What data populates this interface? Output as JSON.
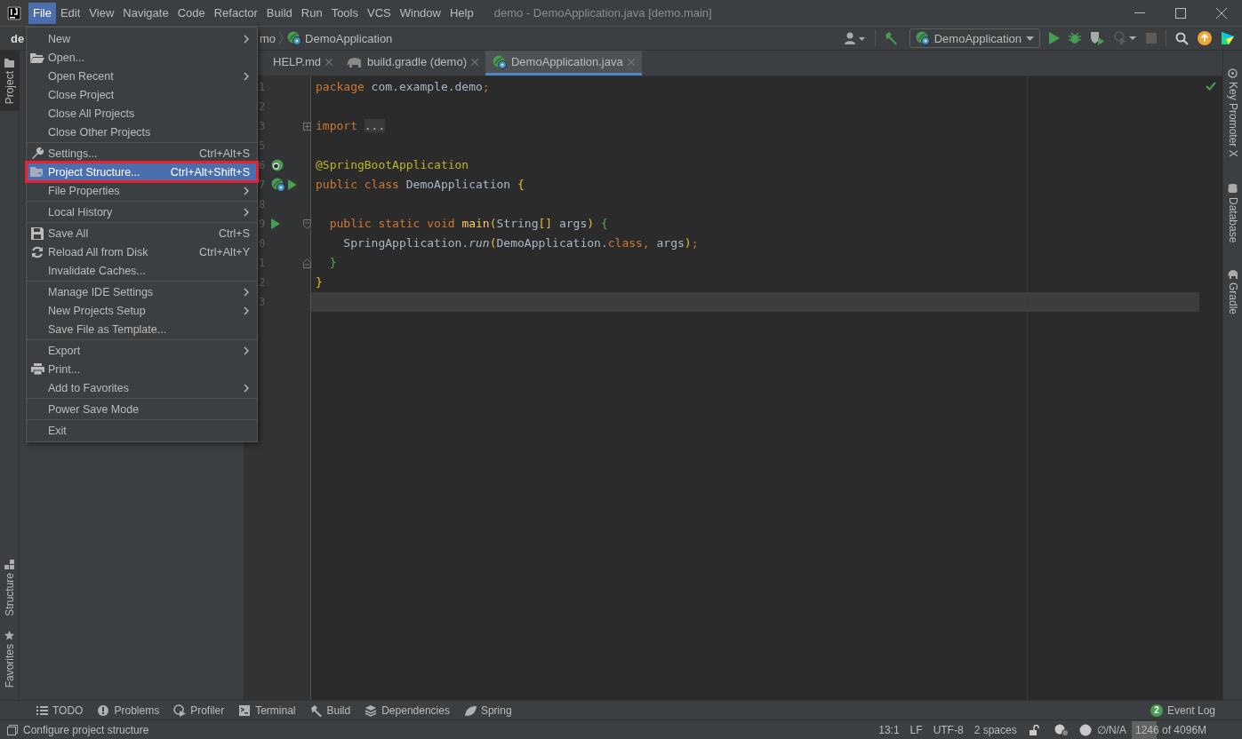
{
  "window": {
    "title": "demo - DemoApplication.java [demo.main]"
  },
  "menu_bar": [
    {
      "label": "File",
      "selected": true
    },
    {
      "label": "Edit",
      "selected": false
    },
    {
      "label": "View",
      "selected": false
    },
    {
      "label": "Navigate",
      "selected": false
    },
    {
      "label": "Code",
      "selected": false
    },
    {
      "label": "Refactor",
      "selected": false
    },
    {
      "label": "Build",
      "selected": false
    },
    {
      "label": "Run",
      "selected": false
    },
    {
      "label": "Tools",
      "selected": false
    },
    {
      "label": "VCS",
      "selected": false
    },
    {
      "label": "Window",
      "selected": false
    },
    {
      "label": "Help",
      "selected": false
    }
  ],
  "navigation_bar": {
    "project": "de",
    "breadcrumbs": [
      "mo",
      "DemoApplication"
    ],
    "run_configuration": "DemoApplication"
  },
  "file_menu": [
    {
      "kind": "item",
      "label": "New",
      "submenu": true,
      "selected": false
    },
    {
      "kind": "item",
      "label": "Open...",
      "submenu": false,
      "selected": false
    },
    {
      "kind": "item",
      "label": "Open Recent",
      "submenu": true,
      "selected": false
    },
    {
      "kind": "item",
      "label": "Close Project",
      "submenu": false,
      "selected": false
    },
    {
      "kind": "item",
      "label": "Close All Projects",
      "submenu": false,
      "selected": false
    },
    {
      "kind": "item",
      "label": "Close Other Projects",
      "submenu": false,
      "selected": false
    },
    {
      "kind": "separator"
    },
    {
      "kind": "item",
      "label": "Settings...",
      "shortcut": "Ctrl+Alt+S",
      "submenu": false,
      "selected": false
    },
    {
      "kind": "item",
      "label": "Project Structure...",
      "shortcut": "Ctrl+Alt+Shift+S",
      "submenu": false,
      "selected": true
    },
    {
      "kind": "item",
      "label": "File Properties",
      "submenu": true,
      "selected": false
    },
    {
      "kind": "separator"
    },
    {
      "kind": "item",
      "label": "Local History",
      "submenu": true,
      "selected": false
    },
    {
      "kind": "separator"
    },
    {
      "kind": "item",
      "label": "Save All",
      "shortcut": "Ctrl+S",
      "submenu": false,
      "selected": false
    },
    {
      "kind": "item",
      "label": "Reload All from Disk",
      "shortcut": "Ctrl+Alt+Y",
      "submenu": false,
      "selected": false
    },
    {
      "kind": "item",
      "label": "Invalidate Caches...",
      "submenu": false,
      "selected": false
    },
    {
      "kind": "separator"
    },
    {
      "kind": "item",
      "label": "Manage IDE Settings",
      "submenu": true,
      "selected": false
    },
    {
      "kind": "item",
      "label": "New Projects Setup",
      "submenu": true,
      "selected": false
    },
    {
      "kind": "item",
      "label": "Save File as Template...",
      "submenu": false,
      "selected": false
    },
    {
      "kind": "separator"
    },
    {
      "kind": "item",
      "label": "Export",
      "submenu": true,
      "selected": false
    },
    {
      "kind": "item",
      "label": "Print...",
      "submenu": false,
      "selected": false
    },
    {
      "kind": "item",
      "label": "Add to Favorites",
      "submenu": true,
      "selected": false
    },
    {
      "kind": "separator"
    },
    {
      "kind": "item",
      "label": "Power Save Mode",
      "submenu": false,
      "selected": false
    },
    {
      "kind": "separator"
    },
    {
      "kind": "item",
      "label": "Exit",
      "submenu": false,
      "selected": false
    }
  ],
  "left_stripe": {
    "top": [
      {
        "label": "Project",
        "selected": true
      }
    ],
    "bottom": [
      {
        "label": "Structure",
        "selected": false
      },
      {
        "label": "Favorites",
        "selected": false
      }
    ]
  },
  "right_stripe": [
    {
      "label": "Key Promoter X"
    },
    {
      "label": "Database"
    },
    {
      "label": "Gradle"
    }
  ],
  "editor_tabs": [
    {
      "label": "HELP.md",
      "selected": false
    },
    {
      "label": "build.gradle (demo)",
      "selected": false
    },
    {
      "label": "DemoApplication.java",
      "selected": true
    }
  ],
  "code_lines": [
    {
      "number": "1",
      "current": false,
      "tokens": [
        {
          "kind": "keyword",
          "text": "package"
        },
        {
          "kind": "plain",
          "text": " com.example.demo"
        },
        {
          "kind": "keyword",
          "text": ";"
        }
      ]
    },
    {
      "number": "2"
    },
    {
      "number": "3",
      "current": false,
      "tokens": [
        {
          "kind": "keyword",
          "text": "import "
        },
        {
          "kind": "folded",
          "text": "..."
        }
      ]
    },
    {
      "number": "5"
    },
    {
      "number": "6",
      "current": false,
      "tokens": [
        {
          "kind": "annotation",
          "text": "@SpringBootApplication"
        }
      ]
    },
    {
      "number": "7",
      "current": false,
      "tokens": [
        {
          "kind": "keyword",
          "text": "public class "
        },
        {
          "kind": "plain",
          "text": "DemoApplication "
        },
        {
          "kind": "bracket_1",
          "text": "{"
        }
      ]
    },
    {
      "number": "8"
    },
    {
      "number": "9",
      "current": false,
      "tokens": [
        {
          "kind": "keyword",
          "text": "  public static void "
        },
        {
          "kind": "method",
          "text": "main"
        },
        {
          "kind": "bracket_1",
          "text": "("
        },
        {
          "kind": "plain",
          "text": "String"
        },
        {
          "kind": "bracket_1",
          "text": "[]"
        },
        {
          "kind": "plain",
          "text": " args"
        },
        {
          "kind": "bracket_1",
          "text": ")"
        },
        {
          "kind": "bracket_2",
          "text": " {"
        }
      ]
    },
    {
      "number": "0",
      "current": false,
      "tokens": [
        {
          "kind": "plain",
          "text": "    SpringApplication."
        },
        {
          "kind": "static_call",
          "text": "run"
        },
        {
          "kind": "bracket_1",
          "text": "("
        },
        {
          "kind": "plain",
          "text": "DemoApplication."
        },
        {
          "kind": "keyword",
          "text": "class, "
        },
        {
          "kind": "plain",
          "text": "args"
        },
        {
          "kind": "bracket_1",
          "text": ")"
        },
        {
          "kind": "keyword",
          "text": ";"
        }
      ]
    },
    {
      "number": "1",
      "current": false,
      "tokens": [
        {
          "kind": "bracket_2",
          "text": "  }"
        }
      ]
    },
    {
      "number": "2",
      "current": false,
      "tokens": [
        {
          "kind": "bracket_1",
          "text": "}"
        }
      ]
    },
    {
      "number": "3",
      "current": true
    }
  ],
  "tool_windows": [
    {
      "label": "TODO"
    },
    {
      "label": "Problems"
    },
    {
      "label": "Profiler"
    },
    {
      "label": "Terminal"
    },
    {
      "label": "Build"
    },
    {
      "label": "Dependencies"
    },
    {
      "label": "Spring"
    }
  ],
  "event_log": {
    "count": "2",
    "label": "Event Log"
  },
  "status_bar": {
    "message": "Configure project structure",
    "position": "13:1",
    "line_separator": "LF",
    "encoding": "UTF-8",
    "indent": "2 spaces",
    "vcs": "∅/N/A",
    "memory": {
      "text": "1246 of 4096M",
      "level": 0.3
    }
  }
}
